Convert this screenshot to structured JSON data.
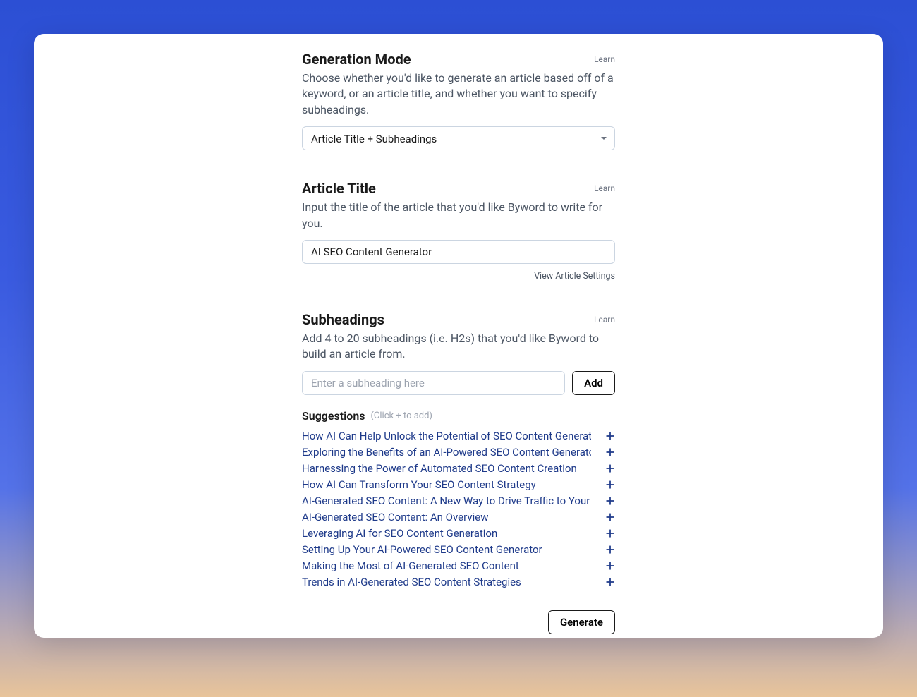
{
  "generation_mode": {
    "title": "Generation Mode",
    "learn": "Learn",
    "description": "Choose whether you'd like to generate an article based off of a keyword, or an article title, and whether you want to specify subheadings.",
    "selected": "Article Title + Subheadings"
  },
  "article_title": {
    "title": "Article Title",
    "learn": "Learn",
    "description": "Input the title of the article that you'd like Byword to write for you.",
    "value": "AI SEO Content Generator",
    "settings_link": "View Article Settings"
  },
  "subheadings": {
    "title": "Subheadings",
    "learn": "Learn",
    "description": "Add 4 to 20 subheadings (i.e. H2s) that you'd like Byword to build an article from.",
    "input_placeholder": "Enter a subheading here",
    "add_button": "Add",
    "suggestions_title": "Suggestions",
    "suggestions_hint": "(Click + to add)",
    "suggestions": [
      "How AI Can Help Unlock the Potential of SEO Content Generation",
      "Exploring the Benefits of an AI-Powered SEO Content Generator",
      "Harnessing the Power of Automated SEO Content Creation",
      "How AI Can Transform Your SEO Content Strategy",
      "AI-Generated SEO Content: A New Way to Drive Traffic to Your Si",
      "AI-Generated SEO Content: An Overview",
      "Leveraging AI for SEO Content Generation",
      "Setting Up Your AI-Powered SEO Content Generator",
      "Making the Most of AI-Generated SEO Content",
      "Trends in AI-Generated SEO Content Strategies"
    ]
  },
  "generate_button": "Generate"
}
